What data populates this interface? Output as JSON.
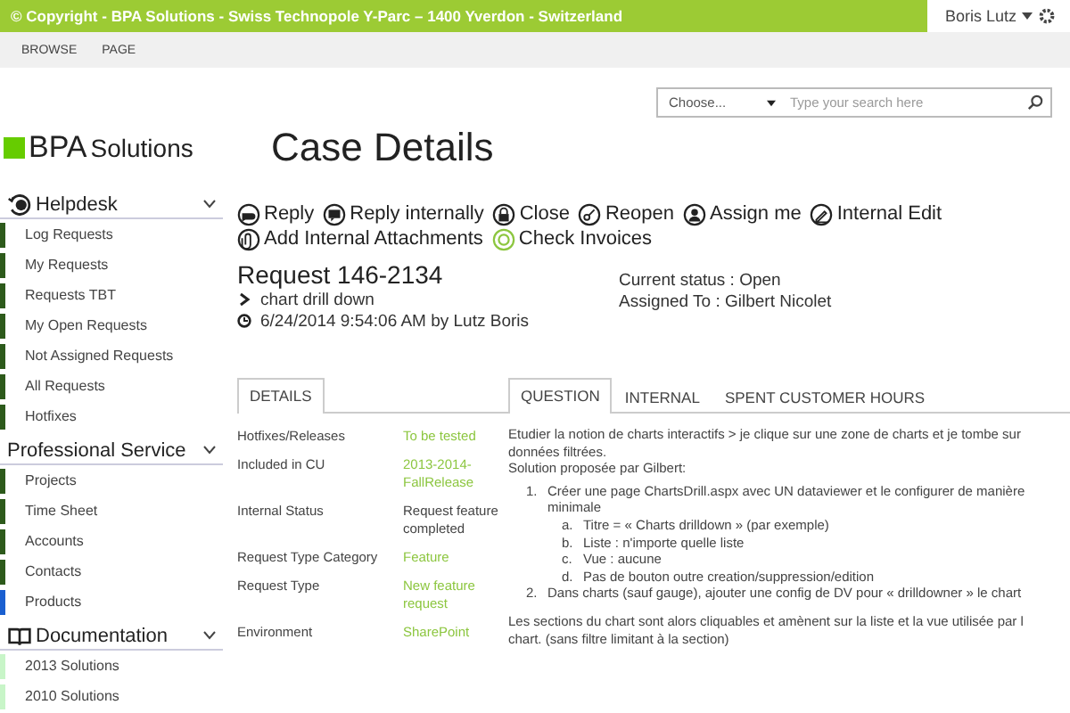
{
  "top_bar": {
    "copyright": "© Copyright - BPA Solutions - Swiss Technopole Y-Parc – 1400 Yverdon - Switzerland",
    "user": "Boris Lutz"
  },
  "ribbon_tabs": [
    "BROWSE",
    "PAGE"
  ],
  "search": {
    "scope": "Choose...",
    "placeholder": "Type your search here"
  },
  "logo": {
    "brand": "BPA",
    "suffix": "Solutions"
  },
  "page_title": "Case Details",
  "sidebar": {
    "sections": [
      {
        "title": "Helpdesk",
        "kind": "clock",
        "items": [
          {
            "label": "Log Requests",
            "color": "#2d5a1b"
          },
          {
            "label": "My Requests",
            "color": "#2d5a1b"
          },
          {
            "label": "Requests TBT",
            "color": "#2d5a1b"
          },
          {
            "label": "My Open Requests",
            "color": "#2d5a1b"
          },
          {
            "label": "Not Assigned Requests",
            "color": "#2d5a1b"
          },
          {
            "label": "All Requests",
            "color": "#2d5a1b"
          },
          {
            "label": "Hotfixes",
            "color": "#2d5a1b"
          }
        ]
      },
      {
        "title": "Professional Service",
        "kind": "plain",
        "items": [
          {
            "label": "Projects",
            "color": "#2d5a1b"
          },
          {
            "label": "Time Sheet",
            "color": "#2d5a1b"
          },
          {
            "label": "Accounts",
            "color": "#2d5a1b"
          },
          {
            "label": "Contacts",
            "color": "#2d5a1b"
          },
          {
            "label": "Products",
            "color": "#1a5fd0"
          }
        ]
      },
      {
        "title": "Documentation",
        "kind": "book",
        "items": [
          {
            "label": "2013 Solutions",
            "color": "#c8f5c8"
          },
          {
            "label": "2010 Solutions",
            "color": "#c8f5c8"
          }
        ]
      }
    ]
  },
  "actions": [
    {
      "label": "Reply",
      "kind": "reply"
    },
    {
      "label": "Reply internally",
      "kind": "reply_internal"
    },
    {
      "label": "Close",
      "kind": "lock"
    },
    {
      "label": "Reopen",
      "kind": "key"
    },
    {
      "label": "Assign me",
      "kind": "person"
    },
    {
      "label": "Internal Edit",
      "kind": "pencil"
    },
    {
      "label": "Add Internal Attachments",
      "kind": "clip"
    },
    {
      "label": "Check Invoices",
      "kind": "invoice"
    }
  ],
  "request": {
    "title": "Request 146-2134",
    "subject": "chart drill down",
    "created": "6/24/2014 9:54:06 AM by Lutz Boris",
    "status": "Current status : Open",
    "assigned": "Assigned To : Gilbert Nicolet"
  },
  "details_tabs": [
    {
      "label": "DETAILS",
      "selected": true
    }
  ],
  "question_tabs": [
    {
      "label": "QUESTION",
      "selected": true
    },
    {
      "label": "INTERNAL",
      "selected": false
    },
    {
      "label": "SPENT CUSTOMER HOURS",
      "selected": false
    }
  ],
  "details": [
    {
      "label": "Hotfixes/Releases",
      "value": "To be tested",
      "kind": "link"
    },
    {
      "label": "Included in CU",
      "value": "2013-2014-FallRelease",
      "kind": "link"
    },
    {
      "label": "Internal Status",
      "value": "Request feature completed",
      "kind": "text"
    },
    {
      "label": "Request Type Category",
      "value": "Feature",
      "kind": "link"
    },
    {
      "label": "Request Type",
      "value": "New feature request",
      "kind": "link"
    },
    {
      "label": "Environment",
      "value": "SharePoint",
      "kind": "link"
    }
  ],
  "question": {
    "intro": [
      "Etudier la notion de charts interactifs > je clique sur une zone de charts et je tombe sur",
      "données filtrées.",
      "Solution proposée par Gilbert:"
    ],
    "steps": [
      {
        "marker": "1.",
        "text": "Créer une page ChartsDrill.aspx avec UN dataviewer et le configurer de manière minimale",
        "substeps": [
          {
            "marker": "a.",
            "text": "Titre = « Charts drilldown » (par exemple)"
          },
          {
            "marker": "b.",
            "text": "Liste : n'importe quelle liste"
          },
          {
            "marker": "c.",
            "text": "Vue : aucune"
          },
          {
            "marker": "d.",
            "text": "Pas de bouton outre creation/suppression/edition"
          }
        ]
      },
      {
        "marker": "2.",
        "text": "Dans charts (sauf gauge), ajouter une config de DV pour « drilldowner » le chart"
      }
    ],
    "outro": [
      "Les sections du chart sont alors cliquables et amènent sur la liste et la vue utilisée par l",
      "chart. (sans filtre limitant à la section)"
    ]
  }
}
